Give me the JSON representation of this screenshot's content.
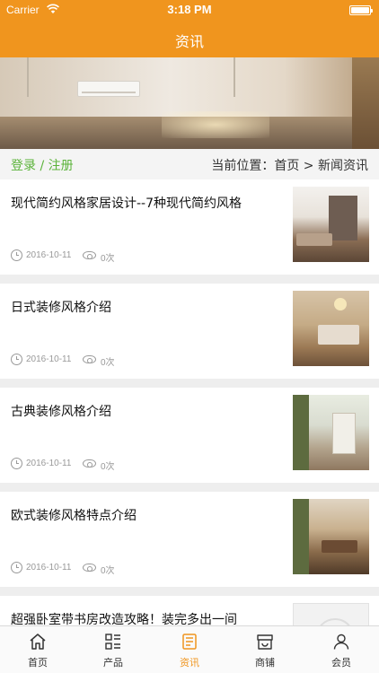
{
  "status_bar": {
    "carrier": "Carrier",
    "time": "3:18 PM"
  },
  "header": {
    "title": "资讯"
  },
  "breadcrumb": {
    "login_text": "登录 / 注册",
    "location_text": "当前位置：首页 > 新闻资讯"
  },
  "articles": [
    {
      "title": "现代简约风格家居设计--7种现代简约风格",
      "date": "2016-10-11",
      "views": "0次"
    },
    {
      "title": "日式装修风格介绍",
      "date": "2016-10-11",
      "views": "0次"
    },
    {
      "title": "古典装修风格介绍",
      "date": "2016-10-11",
      "views": "0次"
    },
    {
      "title": "欧式装修风格特点介绍",
      "date": "2016-10-11",
      "views": "0次"
    },
    {
      "title": "超强卧室带书房改造攻略！装完多出一间"
    }
  ],
  "tabs": [
    {
      "label": "首页",
      "icon": "home-icon"
    },
    {
      "label": "产品",
      "icon": "grid-list-icon"
    },
    {
      "label": "资讯",
      "icon": "document-icon"
    },
    {
      "label": "商铺",
      "icon": "store-icon"
    },
    {
      "label": "会员",
      "icon": "user-icon"
    }
  ],
  "colors": {
    "accent": "#f0951e",
    "login_green": "#5bb33a",
    "meta_gray": "#999999"
  }
}
